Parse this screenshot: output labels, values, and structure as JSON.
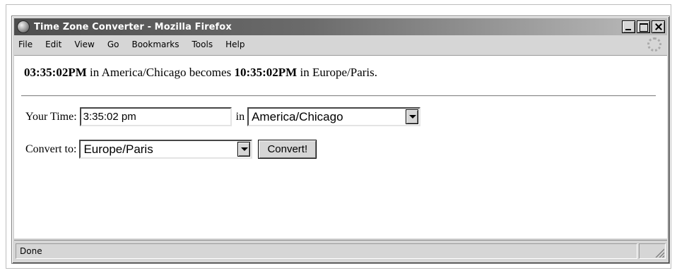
{
  "window": {
    "title": "Time Zone Converter - Mozilla Firefox"
  },
  "menubar": {
    "items": [
      "File",
      "Edit",
      "View",
      "Go",
      "Bookmarks",
      "Tools",
      "Help"
    ]
  },
  "result": {
    "from_time": "03:35:02PM",
    "text_in": "in",
    "from_zone": "America/Chicago",
    "text_becomes": "becomes",
    "to_time": "10:35:02PM",
    "text_in2": "in",
    "to_zone": "Europe/Paris."
  },
  "form": {
    "your_time_label": "Your Time:",
    "your_time_value": "3:35:02 pm",
    "in_label": "in",
    "from_zone_selected": "America/Chicago",
    "convert_to_label": "Convert to:",
    "to_zone_selected": "Europe/Paris",
    "convert_button": "Convert!"
  },
  "status": {
    "text": "Done"
  }
}
